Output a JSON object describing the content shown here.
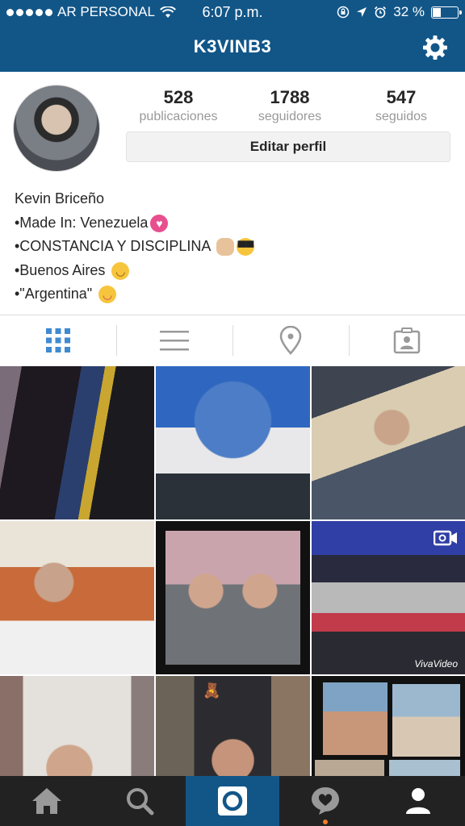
{
  "status_bar": {
    "carrier": "AR PERSONAL",
    "time": "6:07 p.m.",
    "battery_text": "32 %",
    "battery_level": 0.32,
    "icons": [
      "signal-dots-icon",
      "wifi-icon",
      "lock-rotation-icon",
      "location-arrow-icon",
      "alarm-icon",
      "battery-icon"
    ]
  },
  "header": {
    "username": "K3VINB3",
    "settings_icon": "gear-icon"
  },
  "profile": {
    "stats": [
      {
        "number": "528",
        "label": "publicaciones"
      },
      {
        "number": "1788",
        "label": "seguidores"
      },
      {
        "number": "547",
        "label": "seguidos"
      }
    ],
    "edit_button": "Editar perfil",
    "name": "Kevin Briceño",
    "bio_lines": [
      {
        "text": "•Made In: Venezuela",
        "emoji": [
          "sparkling-heart"
        ]
      },
      {
        "text": "•CONSTANCIA Y DISCIPLINA ",
        "emoji": [
          "flexed-biceps",
          "sunglasses-face"
        ]
      },
      {
        "text": "•Buenos Aires ",
        "emoji": [
          "hugging-face"
        ]
      },
      {
        "text": "•\"Argentina\" ",
        "emoji": [
          "yum-face"
        ]
      }
    ]
  },
  "view_tabs": [
    {
      "icon": "grid-icon",
      "active": true
    },
    {
      "icon": "list-icon",
      "active": false
    },
    {
      "icon": "location-pin-icon",
      "active": false
    },
    {
      "icon": "tagged-photos-icon",
      "active": false
    }
  ],
  "photo_grid": {
    "watermark": "VivaVideo",
    "video_badge_icon": "video-camera-icon"
  },
  "bottom_nav": [
    {
      "icon": "home-icon",
      "active": false
    },
    {
      "icon": "search-icon",
      "active": false
    },
    {
      "icon": "camera-icon",
      "active": true
    },
    {
      "icon": "activity-heart-icon",
      "active": false,
      "has_notification": true
    },
    {
      "icon": "profile-icon",
      "active": false
    }
  ],
  "colors": {
    "brand_blue": "#125688",
    "tab_active": "#3f8ad1",
    "tab_inactive": "#999999",
    "bottom_bar": "#222222",
    "notification": "#f57c2a"
  }
}
